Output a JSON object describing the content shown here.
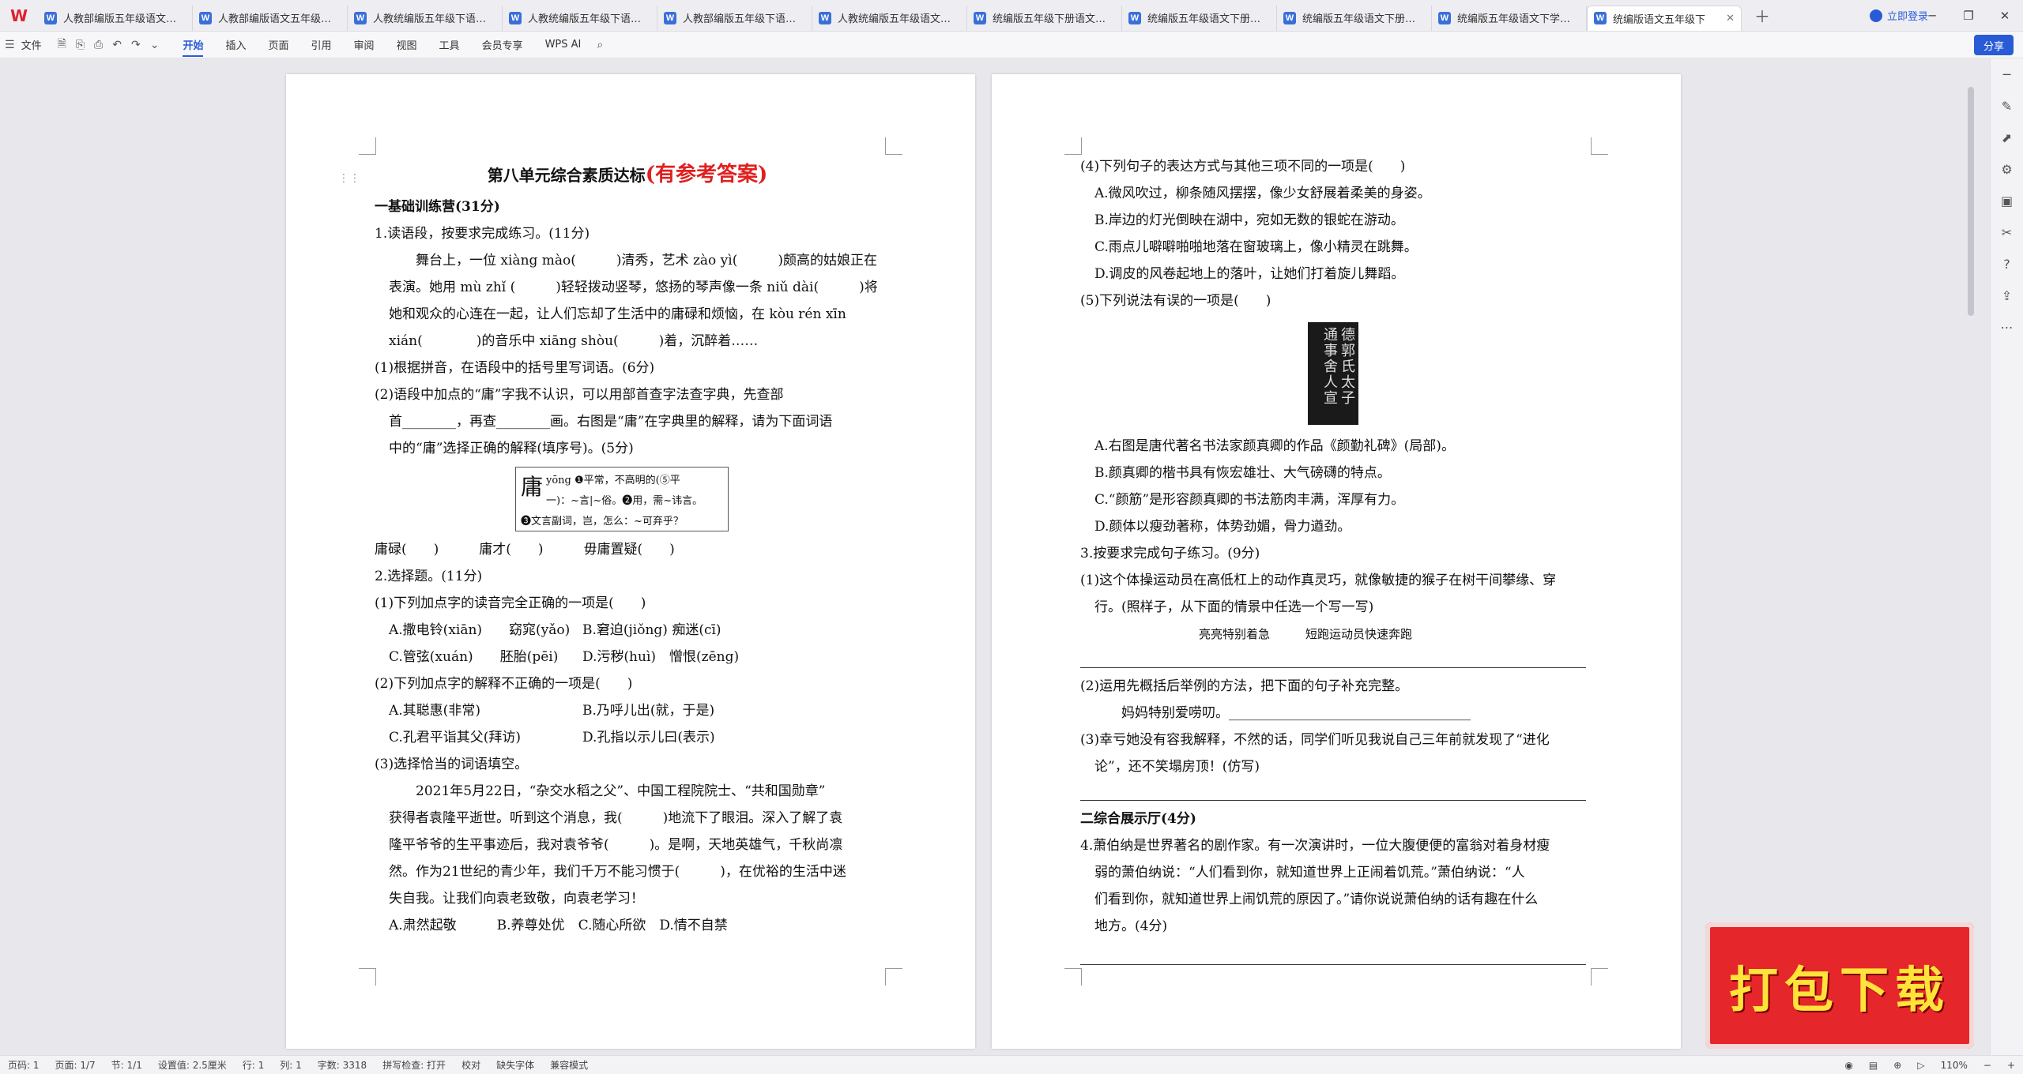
{
  "tabs": [
    {
      "label": "人教部编版五年级语文下册第"
    },
    {
      "label": "人教部编版语文五年级下册第"
    },
    {
      "label": "人教统编版五年级下语文第八"
    },
    {
      "label": "人教统编版五年级下语文第八"
    },
    {
      "label": "人教部编版五年级下语文第八"
    },
    {
      "label": "人教统编版五年级语文下册"
    },
    {
      "label": "统编版五年级下册语文第八单"
    },
    {
      "label": "统编版五年级语文下册第八单"
    },
    {
      "label": "统编版五年级语文下册第八单"
    },
    {
      "label": "统编版五年级语文下学期第八"
    },
    {
      "label": "统编版语文五年级下"
    }
  ],
  "header": {
    "login": "立即登录",
    "share": "分享"
  },
  "toolbar": {
    "file": "文件",
    "menus": [
      "开始",
      "插入",
      "页面",
      "引用",
      "审阅",
      "视图",
      "工具",
      "会员专享"
    ],
    "wps_ai": "WPS AI"
  },
  "page1": {
    "title": "第八单元综合素质达标",
    "title_tag": "(有参考答案)",
    "lines": [
      "一基础训练营(31分)",
      "1.读语段，按要求完成练习。(11分)",
      "舞台上，一位 xiàng mào(　　　)清秀，艺术 zào yì(　　　)颇高的姑娘正在",
      "表演。她用 mù zhǐ (　　　)轻轻拨动竖琴，悠扬的琴声像一条 niǔ dài(　　　)将",
      "她和观众的心连在一起，让人们忘却了生活中的庸碌和烦恼，在 kòu rén xīn",
      "xián(　　　　)的音乐中 xiāng shòu(　　　)着，沉醉着……",
      "(1)根据拼音，在语段中的括号里写词语。(6分)",
      "(2)语段中加点的“庸”字我不认识，可以用部首查字法查字典，先查部",
      "首________，再查________画。右图是“庸”在字典里的解释，请为下面词语",
      "中的“庸”选择正确的解释(填序号)。(5分)"
    ],
    "dict": {
      "char": "庸",
      "pinyin": "yōng",
      "l1": "❶平常，不高明的(⑤平",
      "l2": "一)：~言|~俗。❷用，需~讳言。",
      "l3": "❸文言副词，岂，怎么：~可弃乎？"
    },
    "words": "庸碌(　　)　　　庸才(　　)　　　毋庸置疑(　　)",
    "q2": "2.选择题。(11分)",
    "q2_1": "(1)下列加点字的读音完全正确的一项是(　　)",
    "q2_1_opts": [
      "A.撒电铃(xiān)　　窈窕(yǎo)",
      "B.窘迫(jiǒng) 痴迷(cī)",
      "C.管弦(xuán)　　胚胎(pēi)",
      "D.污秽(huì)　憎恨(zēng)"
    ],
    "q2_2": "(2)下列加点字的解释不正确的一项是(　　)",
    "q2_2_opts": [
      "A.其聪惠(非常)",
      "B.乃呼儿出(就，于是)",
      "C.孔君平诣其父(拜访)",
      "D.孔指以示儿曰(表示)"
    ],
    "q2_3": "(3)选择恰当的词语填空。",
    "passage": [
      "2021年5月22日，“杂交水稻之父”、中国工程院院士、“共和国勋章”",
      "获得者袁隆平逝世。听到这个消息，我(　　　)地流下了眼泪。深入了解了袁",
      "隆平爷爷的生平事迹后，我对袁爷爷(　　　)。是啊，天地英雄气，千秋尚凛",
      "然。作为21世纪的青少年，我们千万不能习惯于(　　　)，在优裕的生活中迷",
      "失自我。让我们向袁老致敬，向袁老学习！"
    ],
    "q2_3_opts": "A.肃然起敬　　　B.养尊处优　C.随心所欲　D.情不自禁"
  },
  "page2": {
    "q4": "(4)下列句子的表达方式与其他三项不同的一项是(　　)",
    "q4_opts": [
      "A.微风吹过，柳条随风摆摆，像少女舒展着柔美的身姿。",
      "B.岸边的灯光倒映在湖中，宛如无数的银蛇在游动。",
      "C.雨点儿噼噼啪啪地落在窗玻璃上，像小精灵在跳舞。",
      "D.调皮的风卷起地上的落叶，让她们打着旋儿舞蹈。"
    ],
    "q5": "(5)下列说法有误的一项是(　　)",
    "calli": "德郭氏太子通事舍人宣",
    "q5_opts": [
      "A.右图是唐代著名书法家颜真卿的作品《颜勤礼碑》(局部)。",
      "B.颜真卿的楷书具有恢宏雄壮、大气磅礴的特点。",
      "C.“颜筋”是形容颜真卿的书法筋肉丰满，浑厚有力。",
      "D.颜体以瘦劲著称，体势劲媚，骨力遒劲。"
    ],
    "q3": "3.按要求完成句子练习。(9分)",
    "q3_1a": "(1)这个体操运动员在高低杠上的动作真灵巧，就像敏捷的猴子在树干间攀缘、穿",
    "q3_1b": "行。(照样子，从下面的情景中任选一个写一写)",
    "q3_1c": "亮亮特别着急　　　短跑运动员快速奔跑",
    "q3_2": "(2)运用先概括后举例的方法，把下面的句子补充完整。",
    "q3_2b": "妈妈特别爱唠叨。____________________________________",
    "q3_3a": "(3)幸亏她没有容我解释，不然的话，同学们听见我说自己三年前就发现了“进化",
    "q3_3b": "论”，还不笑塌房顶！(仿写)",
    "s2": "二综合展示厅(4分)",
    "q4b_a": "4.萧伯纳是世界著名的剧作家。有一次演讲时，一位大腹便便的富翁对着身材瘦",
    "q4b_b": "弱的萧伯纳说：“人们看到你，就知道世界上正闹着饥荒。”萧伯纳说：“人",
    "q4b_c": "们看到你，就知道世界上闹饥荒的原因了。”请你说说萧伯纳的话有趣在什么",
    "q4b_d": "地方。(4分)"
  },
  "download_badge": "打包下载",
  "status": {
    "page_code": "页码: 1",
    "page": "页面: 1/7",
    "section": "节: 1/1",
    "setting": "设置值: 2.5厘米",
    "row": "行: 1",
    "col": "列: 1",
    "words": "字数: 3318",
    "spell": "拼写检查: 打开",
    "proof": "校对",
    "missing_font": "缺失字体",
    "compat": "兼容模式",
    "zoom": "110%"
  }
}
